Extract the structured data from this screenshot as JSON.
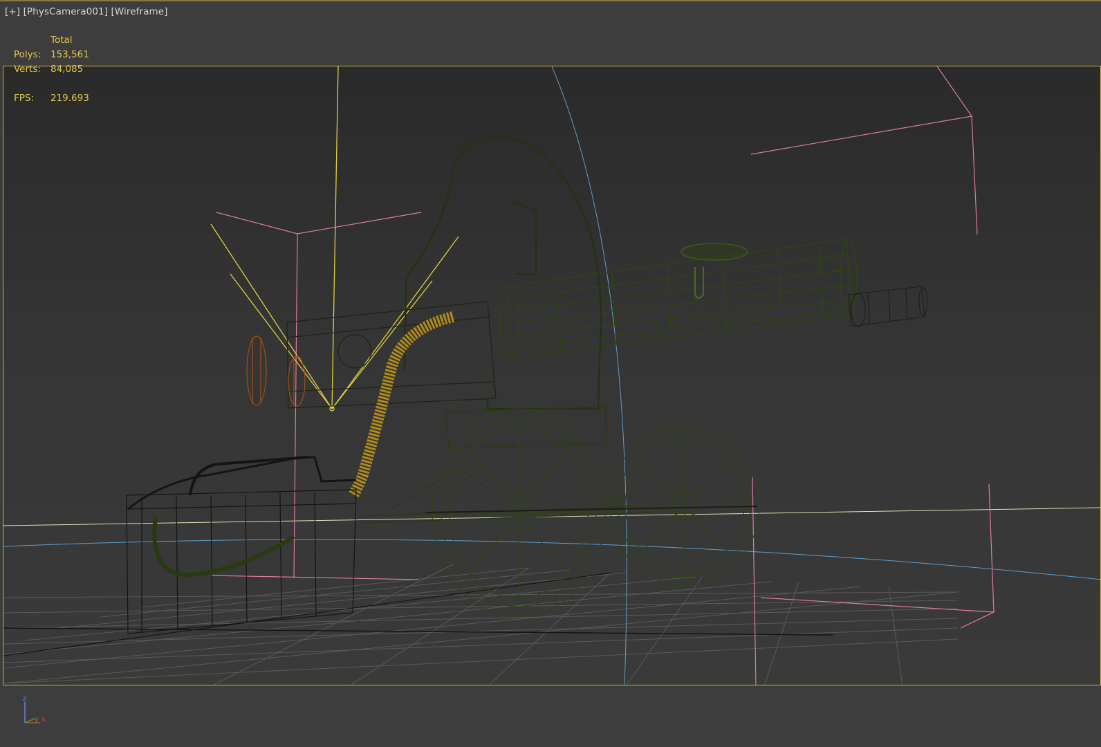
{
  "viewport": {
    "label_plus": "[+]",
    "label_camera": "[PhysCamera001]",
    "label_mode": "[Wireframe]"
  },
  "stats": {
    "header": "Total",
    "polys_label": "Polys:",
    "polys_value": "153,561",
    "verts_label": "Verts:",
    "verts_value": "84,085",
    "fps_label": "FPS:",
    "fps_value": "219.693"
  },
  "axis": {
    "z": "z",
    "y": "y",
    "x": "x"
  },
  "colors": {
    "stats_text": "#e3c84a",
    "safe_frame": "#c9b740",
    "light_gizmo": "#e0d040",
    "helper_pink": "#e07aa8",
    "axis_blue": "#5a9fd0",
    "mesh_dark_green": "#2a3a10",
    "mesh_green": "#3e5a1a",
    "ammo_belt": "#b08a1a",
    "handles": "#a0501a",
    "grid": "#6c6c6c"
  }
}
